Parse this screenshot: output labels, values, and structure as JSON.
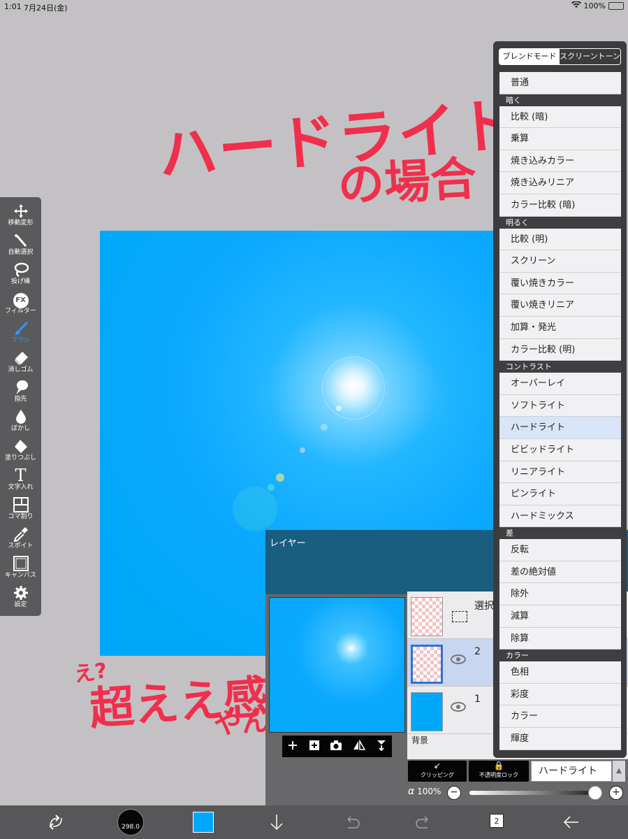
{
  "status_bar": {
    "time": "1:01",
    "date": "7月24日(金)",
    "battery": "100%"
  },
  "annotations": {
    "title": "ハードライト",
    "subtitle": "の場合",
    "note_small": "え?",
    "note_main": "超ええ感じ",
    "note_tail": "やん"
  },
  "toolbar": {
    "items": [
      {
        "label": "移動変形",
        "icon": "move-icon"
      },
      {
        "label": "自動選択",
        "icon": "magic-wand-icon"
      },
      {
        "label": "投げ縄",
        "icon": "lasso-icon"
      },
      {
        "label": "フィルター",
        "icon": "fx-icon",
        "glyph": "FX"
      },
      {
        "label": "ブラシ",
        "icon": "brush-icon"
      },
      {
        "label": "消しゴム",
        "icon": "eraser-icon"
      },
      {
        "label": "指先",
        "icon": "finger-icon"
      },
      {
        "label": "ぼかし",
        "icon": "blur-icon"
      },
      {
        "label": "塗りつぶし",
        "icon": "fill-icon"
      },
      {
        "label": "文字入れ",
        "icon": "text-icon",
        "glyph": "T"
      },
      {
        "label": "コマ割り",
        "icon": "frame-divider-icon"
      },
      {
        "label": "スポイト",
        "icon": "eyedropper-icon"
      },
      {
        "label": "キャンバス",
        "icon": "canvas-icon"
      },
      {
        "label": "設定",
        "icon": "gear-icon"
      }
    ],
    "active": "ブラシ",
    "accent_color": "#2f9bff"
  },
  "blend_panel": {
    "tab_blend": "ブレンドモード",
    "tab_screentone": "スクリーントーン",
    "selected": "ハードライト",
    "rows": [
      {
        "type": "item",
        "label": "普通"
      },
      {
        "type": "header",
        "label": "暗く"
      },
      {
        "type": "item",
        "label": "比較 (暗)"
      },
      {
        "type": "item",
        "label": "乗算"
      },
      {
        "type": "item",
        "label": "焼き込みカラー"
      },
      {
        "type": "item",
        "label": "焼き込みリニア"
      },
      {
        "type": "item",
        "label": "カラー比較 (暗)"
      },
      {
        "type": "header",
        "label": "明るく"
      },
      {
        "type": "item",
        "label": "比較 (明)"
      },
      {
        "type": "item",
        "label": "スクリーン"
      },
      {
        "type": "item",
        "label": "覆い焼きカラー"
      },
      {
        "type": "item",
        "label": "覆い焼きリニア"
      },
      {
        "type": "item",
        "label": "加算・発光"
      },
      {
        "type": "item",
        "label": "カラー比較 (明)"
      },
      {
        "type": "header",
        "label": "コントラスト"
      },
      {
        "type": "item",
        "label": "オーバーレイ"
      },
      {
        "type": "item",
        "label": "ソフトライト"
      },
      {
        "type": "item",
        "label": "ハードライト"
      },
      {
        "type": "item",
        "label": "ビビッドライト"
      },
      {
        "type": "item",
        "label": "リニアライト"
      },
      {
        "type": "item",
        "label": "ピンライト"
      },
      {
        "type": "item",
        "label": "ハードミックス"
      },
      {
        "type": "header",
        "label": "差"
      },
      {
        "type": "item",
        "label": "反転"
      },
      {
        "type": "item",
        "label": "差の絶対値"
      },
      {
        "type": "item",
        "label": "除外"
      },
      {
        "type": "item",
        "label": "減算"
      },
      {
        "type": "item",
        "label": "除算"
      },
      {
        "type": "header",
        "label": "カラー"
      },
      {
        "type": "item",
        "label": "色相"
      },
      {
        "type": "item",
        "label": "彩度"
      },
      {
        "type": "item",
        "label": "カラー"
      },
      {
        "type": "item",
        "label": "輝度"
      }
    ]
  },
  "layer_panel": {
    "title": "レイヤー",
    "layers": [
      {
        "name": "選択L",
        "kind": "selection"
      },
      {
        "name": "2",
        "kind": "light"
      },
      {
        "name": "1",
        "kind": "fill"
      }
    ],
    "background_label": "背景",
    "clipping_label": "クリッピング",
    "lock_alpha_label": "不透明度ロック",
    "blend_mode_value": "ハードライト",
    "alpha_symbol": "α",
    "opacity": "100%",
    "opacity_value": 1.0,
    "tools": [
      "add-layer-icon",
      "add-sublayer-icon",
      "camera-icon",
      "flip-icon",
      "merge-down-icon"
    ]
  },
  "bottom_bar": {
    "brush_size": "298.0",
    "layer_count": "2",
    "color": "#00a8fb"
  }
}
